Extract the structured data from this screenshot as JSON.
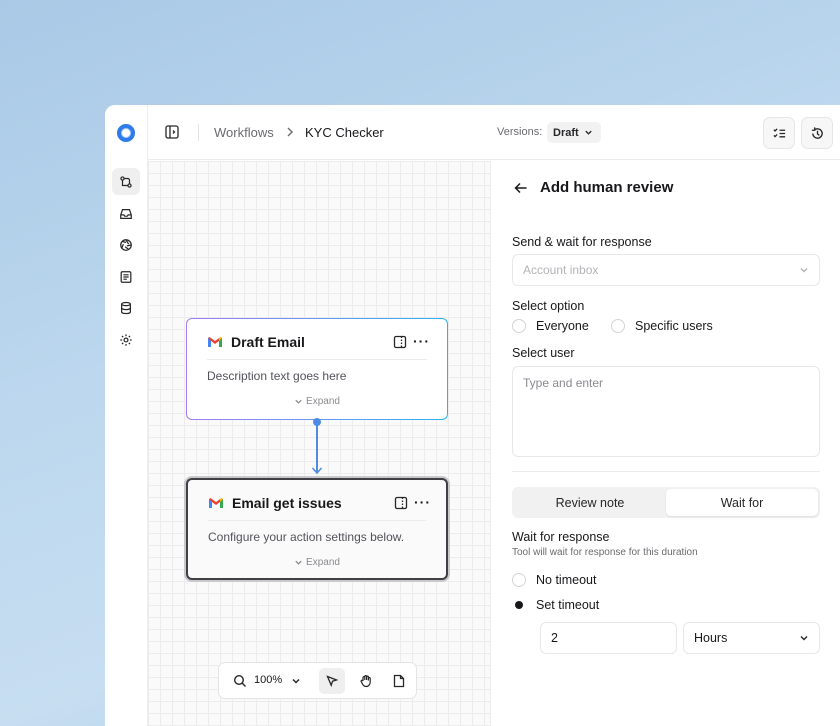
{
  "topbar": {
    "breadcrumb": [
      "Workflows",
      "KYC Checker"
    ],
    "versions_label": "Versions:",
    "version_value": "Draft"
  },
  "sidebar": {
    "items": [
      {
        "icon": "git-branch-icon",
        "active": true
      },
      {
        "icon": "inbox-icon",
        "active": false
      },
      {
        "icon": "aperture-icon",
        "active": false
      },
      {
        "icon": "document-list-icon",
        "active": false
      },
      {
        "icon": "database-icon",
        "active": false
      },
      {
        "icon": "gear-icon",
        "active": false
      }
    ]
  },
  "canvas": {
    "nodes": [
      {
        "title": "Draft Email",
        "description": "Description text goes here",
        "expand_label": "Expand",
        "selected": false
      },
      {
        "title": "Email get issues",
        "description": "Configure your action settings below.",
        "expand_label": "Expand",
        "selected": true
      }
    ],
    "zoom": "100%"
  },
  "panel": {
    "title": "Add human review",
    "send_wait_label": "Send & wait for response",
    "account_placeholder": "Account inbox",
    "select_option_label": "Select option",
    "options": [
      "Everyone",
      "Specific users"
    ],
    "select_user_label": "Select user",
    "user_placeholder": "Type and enter",
    "tabs": [
      "Review note",
      "Wait for"
    ],
    "active_tab": "Wait for",
    "wait_label": "Wait for response",
    "wait_hint": "Tool will wait for response for this duration",
    "timeout_options": [
      "No timeout",
      "Set timeout"
    ],
    "selected_timeout": "Set timeout",
    "timeout_value": "2",
    "timeout_unit": "Hours"
  },
  "colors": {
    "accent_blue": "#2e7bea",
    "connector": "#4d8be6",
    "node_gradient_start": "#a27cf2",
    "node_gradient_end": "#2ab3ee",
    "run_button": "#18181b"
  }
}
